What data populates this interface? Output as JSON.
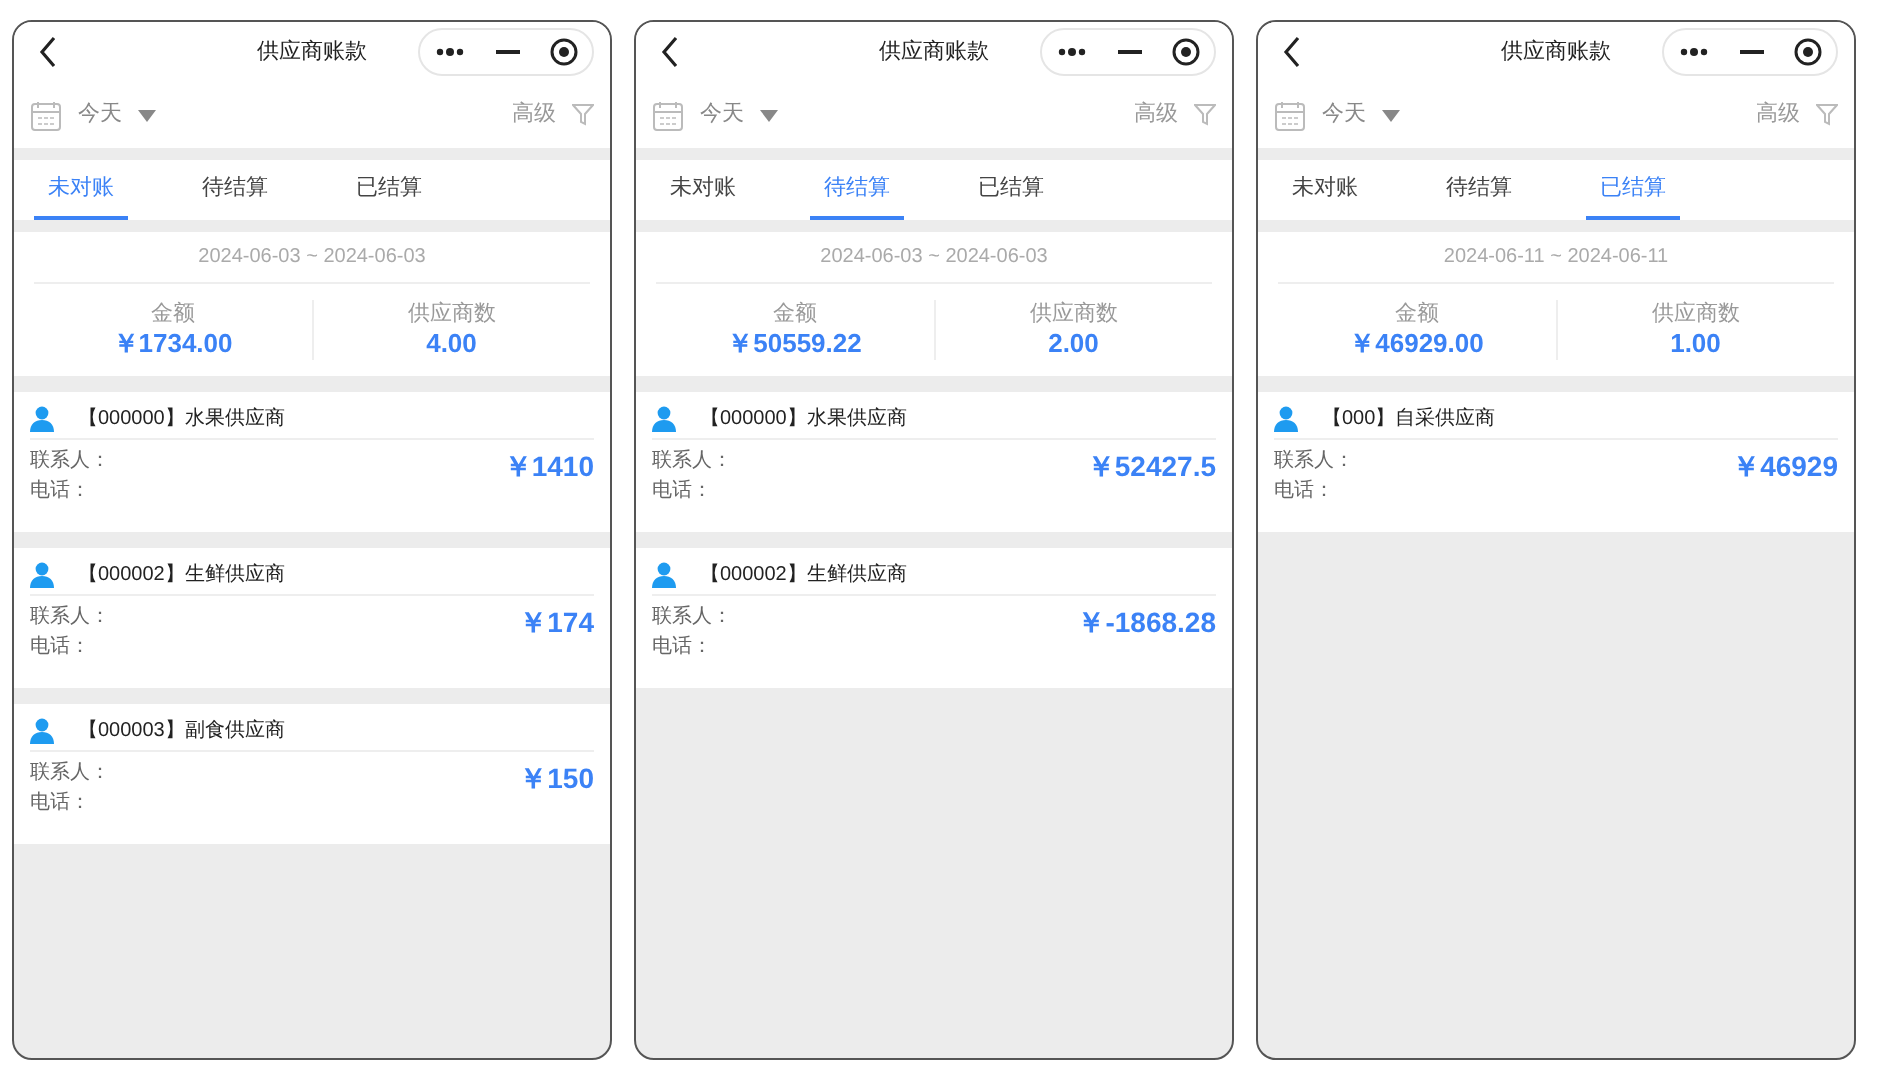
{
  "screens": [
    {
      "title": "供应商账款",
      "date_filter": "今天",
      "advanced": "高级",
      "tabs": [
        {
          "label": "未对账",
          "selected": true
        },
        {
          "label": "待结算",
          "selected": false
        },
        {
          "label": "已结算",
          "selected": false
        }
      ],
      "date_range": "2024-06-03 ~ 2024-06-03",
      "summary": [
        {
          "label": "金额",
          "value": "￥1734.00"
        },
        {
          "label": "供应商数",
          "value": "4.00"
        }
      ],
      "suppliers": [
        {
          "name": "【000000】水果供应商",
          "contact": "联系人：",
          "phone": "电话：",
          "amount": "￥1410"
        },
        {
          "name": "【000002】生鲜供应商",
          "contact": "联系人：",
          "phone": "电话：",
          "amount": "￥174"
        },
        {
          "name": "【000003】副食供应商",
          "contact": "联系人：",
          "phone": "电话：",
          "amount": "￥150"
        }
      ]
    },
    {
      "title": "供应商账款",
      "date_filter": "今天",
      "advanced": "高级",
      "tabs": [
        {
          "label": "未对账",
          "selected": false
        },
        {
          "label": "待结算",
          "selected": true
        },
        {
          "label": "已结算",
          "selected": false
        }
      ],
      "date_range": "2024-06-03 ~ 2024-06-03",
      "summary": [
        {
          "label": "金额",
          "value": "￥50559.22"
        },
        {
          "label": "供应商数",
          "value": "2.00"
        }
      ],
      "suppliers": [
        {
          "name": "【000000】水果供应商",
          "contact": "联系人：",
          "phone": "电话：",
          "amount": "￥52427.5"
        },
        {
          "name": "【000002】生鲜供应商",
          "contact": "联系人：",
          "phone": "电话：",
          "amount": "￥-1868.28"
        }
      ]
    },
    {
      "title": "供应商账款",
      "date_filter": "今天",
      "advanced": "高级",
      "tabs": [
        {
          "label": "未对账",
          "selected": false
        },
        {
          "label": "待结算",
          "selected": false
        },
        {
          "label": "已结算",
          "selected": true
        }
      ],
      "date_range": "2024-06-11 ~ 2024-06-11",
      "summary": [
        {
          "label": "金额",
          "value": "￥46929.00"
        },
        {
          "label": "供应商数",
          "value": "1.00"
        }
      ],
      "suppliers": [
        {
          "name": "【000】自采供应商",
          "contact": "联系人：",
          "phone": "电话：",
          "amount": "￥46929"
        }
      ]
    }
  ]
}
